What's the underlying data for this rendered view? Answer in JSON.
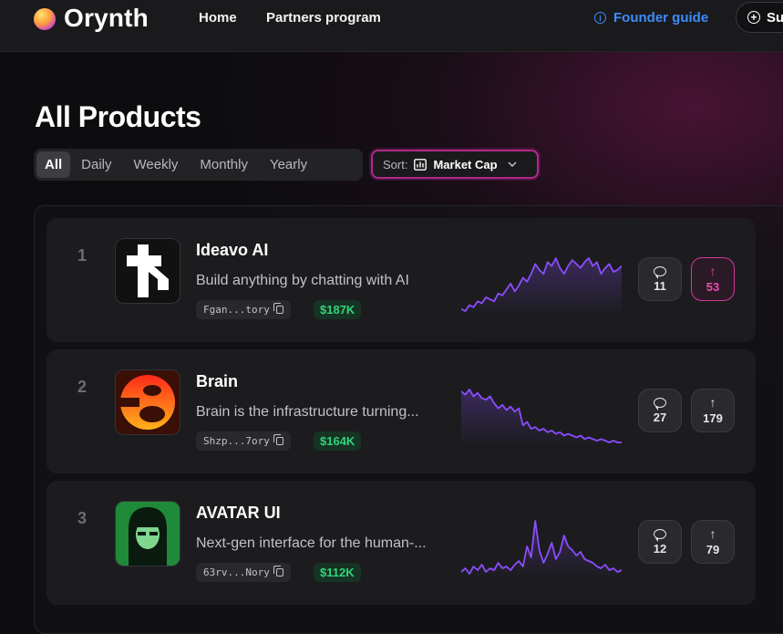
{
  "header": {
    "brand": "Orynth",
    "nav": [
      "Home",
      "Partners program"
    ],
    "founder_guide": "Founder guide",
    "submit_label": "Su"
  },
  "page": {
    "title": "All Products",
    "tabs": [
      "All",
      "Daily",
      "Weekly",
      "Monthly",
      "Yearly"
    ],
    "active_tab": "All",
    "sort": {
      "label": "Sort:",
      "value": "Market Cap"
    }
  },
  "colors": {
    "accent_pink": "#d6359a",
    "market_cap_green": "#32d47a",
    "sparkline_purple": "#8b4dff",
    "link_blue": "#3d8bff"
  },
  "products": [
    {
      "rank": "1",
      "name": "Ideavo AI",
      "description": "Build anything by chatting with AI",
      "address": "Fgan...tory",
      "market_cap": "$187K",
      "comments": "11",
      "upvotes": "53",
      "upvoted": true,
      "trend": [
        12,
        11,
        14,
        13,
        16,
        15,
        18,
        17,
        16,
        20,
        19,
        22,
        25,
        21,
        24,
        28,
        26,
        30,
        35,
        32,
        30,
        36,
        34,
        38,
        33,
        30,
        34,
        37,
        35,
        33,
        36,
        38,
        34,
        36,
        30,
        33,
        35,
        31,
        32,
        34
      ]
    },
    {
      "rank": "2",
      "name": "Brain",
      "description": "Brain is the infrastructure turning...",
      "address": "Shzp...7ory",
      "market_cap": "$164K",
      "comments": "27",
      "upvotes": "179",
      "upvoted": false,
      "trend": [
        40,
        38,
        41,
        37,
        39,
        36,
        35,
        37,
        33,
        30,
        32,
        29,
        31,
        28,
        30,
        20,
        22,
        18,
        19,
        17,
        18,
        16,
        17,
        15,
        16,
        14,
        15,
        14,
        13,
        14,
        12,
        13,
        12,
        11,
        12,
        11,
        10,
        11,
        10,
        10
      ]
    },
    {
      "rank": "3",
      "name": "AVATAR UI",
      "description": "Next-gen interface for the human-...",
      "address": "63rv...Nory",
      "market_cap": "$112K",
      "comments": "12",
      "upvotes": "79",
      "upvoted": false,
      "trend": [
        10,
        12,
        9,
        13,
        11,
        14,
        10,
        12,
        11,
        15,
        12,
        13,
        11,
        14,
        16,
        13,
        24,
        18,
        38,
        22,
        15,
        20,
        26,
        17,
        21,
        30,
        24,
        22,
        19,
        21,
        17,
        16,
        15,
        13,
        12,
        14,
        11,
        12,
        10,
        11
      ]
    }
  ]
}
